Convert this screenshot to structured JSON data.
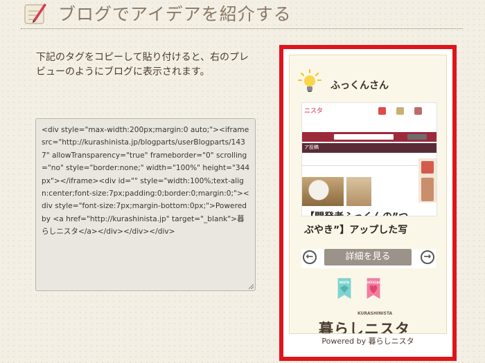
{
  "header": {
    "title": "ブログでアイデアを紹介する",
    "icon": "notepad-pencil-icon"
  },
  "intro": {
    "text": "下記のタグをコピーして貼り付けると、右のプレビューのようにブログに表示されます。"
  },
  "code": {
    "snippet": "<div style=\"max-width:200px;margin:0 auto;\"><iframe src=\"http://kurashinista.jp/blogparts/userBlogparts/1437\" allowTransparency=\"true\" frameborder=\"0\" scrolling=\"no\" style=\"border:none;\" width=\"100%\" height=\"344px\"></iframe><div id=\"\" style=\"width:100%;text-align:center;font-size:7px;padding:0;border:0;margin:0;\"><div style=\"font-size:7px;margin-bottom:0px;\">Powered by <a href=\"http://kurashinista.jp\" target=\"_blank\">暮らしニスタ</a></div></div></div>"
  },
  "preview": {
    "username": "ふっくんさん",
    "user_icon": "lightbulb-icon",
    "screenshot": {
      "logo": "ニスタ",
      "nav": "ア投稿",
      "headline_line1": "【開発者ふっくんの”つ",
      "headline_line2": "ぶやき”】アップした写"
    },
    "detail_label": "詳細を見る",
    "badges": [
      "NISTA",
      "OFFICIAL"
    ],
    "brand": {
      "name": "暮らしニスタ",
      "latin": "KURASHINISTA"
    },
    "powered_by": "Powered by 暮らしニスタ"
  },
  "colors": {
    "frame": "#e0141b",
    "accent": "#9c2a3b",
    "background": "#f3efe4"
  }
}
